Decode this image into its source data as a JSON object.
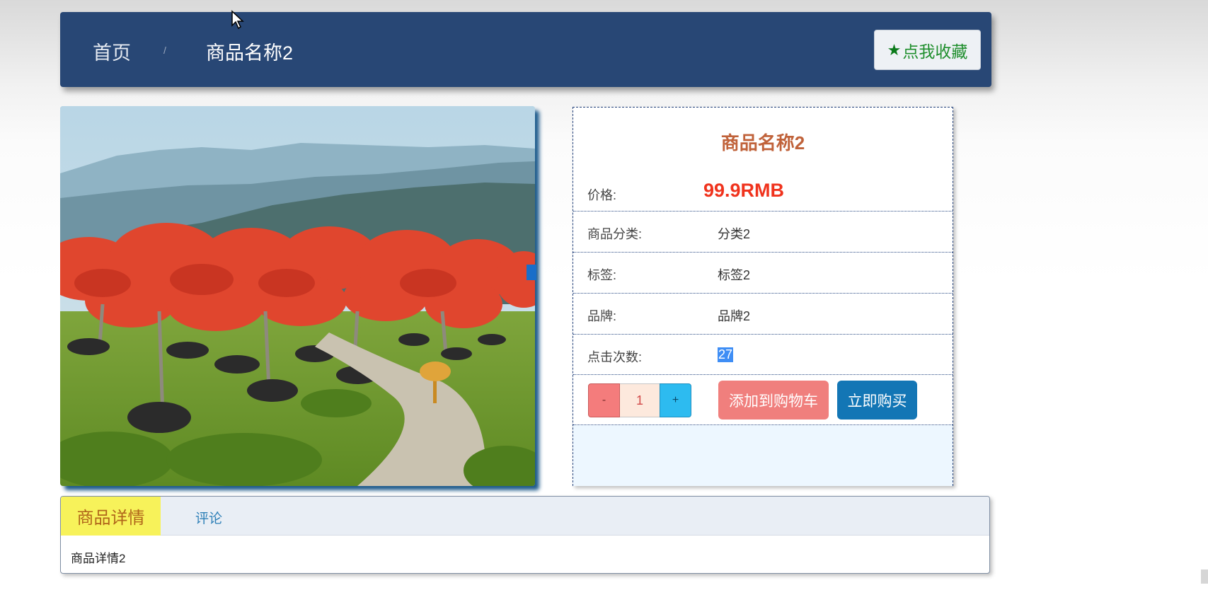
{
  "header": {
    "breadcrumb_home": "首页",
    "breadcrumb_separator": "/",
    "breadcrumb_current": "商品名称2",
    "favorite_label": "点我收藏",
    "favorite_icon": "star-icon"
  },
  "product": {
    "name": "商品名称2",
    "price_label": "价格:",
    "price_value": "99.9RMB",
    "category_label": "商品分类:",
    "category_value": "分类2",
    "tag_label": "标签:",
    "tag_value": "标签2",
    "brand_label": "品牌:",
    "brand_value": "品牌2",
    "clicks_label": "点击次数:",
    "clicks_value": "27",
    "image_alt": "landscape-photo"
  },
  "actions": {
    "minus_label": "-",
    "quantity": "1",
    "plus_label": "+",
    "add_to_cart_label": "添加到购物车",
    "buy_now_label": "立即购买"
  },
  "tabs": {
    "details_label": "商品详情",
    "comments_label": "评论",
    "details_content": "商品详情2"
  },
  "colors": {
    "header_bg": "#284775",
    "title_color": "#c0623a",
    "price_color": "#f0331d",
    "add_cart_bg": "#f07f7d",
    "buy_now_bg": "#1376b5",
    "active_tab_bg": "#f7f25a"
  }
}
